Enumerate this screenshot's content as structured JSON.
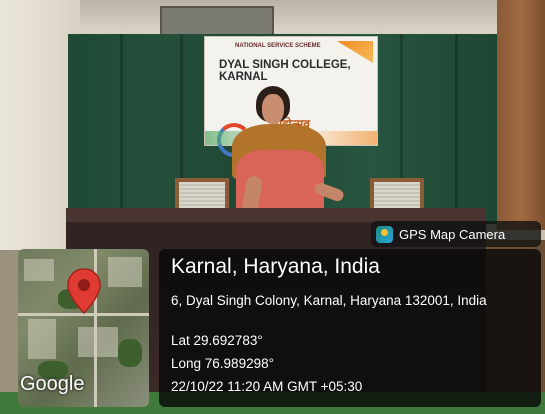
{
  "banner": {
    "org": "NATIONAL SERVICE SCHEME",
    "college": "DYAL SINGH COLLEGE, KARNAL",
    "festival": "महोत्सव"
  },
  "gps_tag": {
    "label": "GPS Map Camera",
    "icon": "gps-map-camera-app-icon"
  },
  "map": {
    "brand": "Google",
    "pin_icon": "location-pin-icon",
    "pin_color": "#e03b32"
  },
  "location": {
    "city": "Karnal, Haryana, India",
    "address": "6, Dyal Singh Colony, Karnal, Haryana 132001, India",
    "lat": "Lat 29.692783°",
    "long": "Long 76.989298°",
    "timestamp": "22/10/22 11:20 AM GMT +05:30"
  }
}
